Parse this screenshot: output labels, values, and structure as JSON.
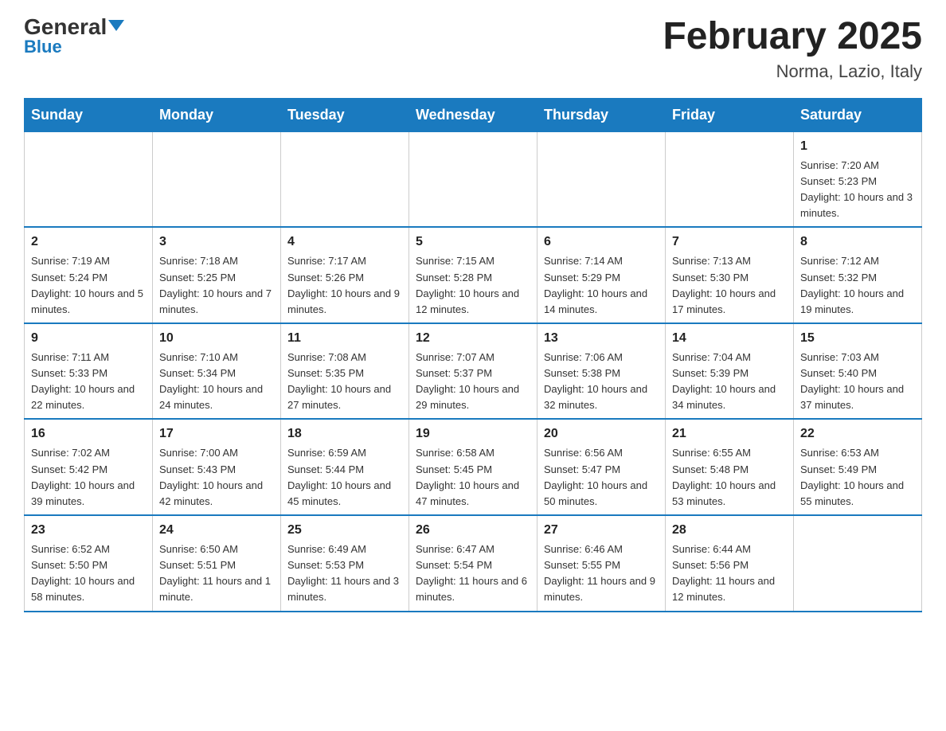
{
  "header": {
    "logo_general": "General",
    "logo_blue": "Blue",
    "month_title": "February 2025",
    "location": "Norma, Lazio, Italy"
  },
  "days_of_week": [
    "Sunday",
    "Monday",
    "Tuesday",
    "Wednesday",
    "Thursday",
    "Friday",
    "Saturday"
  ],
  "weeks": [
    [
      {
        "day": "",
        "info": ""
      },
      {
        "day": "",
        "info": ""
      },
      {
        "day": "",
        "info": ""
      },
      {
        "day": "",
        "info": ""
      },
      {
        "day": "",
        "info": ""
      },
      {
        "day": "",
        "info": ""
      },
      {
        "day": "1",
        "info": "Sunrise: 7:20 AM\nSunset: 5:23 PM\nDaylight: 10 hours and 3 minutes."
      }
    ],
    [
      {
        "day": "2",
        "info": "Sunrise: 7:19 AM\nSunset: 5:24 PM\nDaylight: 10 hours and 5 minutes."
      },
      {
        "day": "3",
        "info": "Sunrise: 7:18 AM\nSunset: 5:25 PM\nDaylight: 10 hours and 7 minutes."
      },
      {
        "day": "4",
        "info": "Sunrise: 7:17 AM\nSunset: 5:26 PM\nDaylight: 10 hours and 9 minutes."
      },
      {
        "day": "5",
        "info": "Sunrise: 7:15 AM\nSunset: 5:28 PM\nDaylight: 10 hours and 12 minutes."
      },
      {
        "day": "6",
        "info": "Sunrise: 7:14 AM\nSunset: 5:29 PM\nDaylight: 10 hours and 14 minutes."
      },
      {
        "day": "7",
        "info": "Sunrise: 7:13 AM\nSunset: 5:30 PM\nDaylight: 10 hours and 17 minutes."
      },
      {
        "day": "8",
        "info": "Sunrise: 7:12 AM\nSunset: 5:32 PM\nDaylight: 10 hours and 19 minutes."
      }
    ],
    [
      {
        "day": "9",
        "info": "Sunrise: 7:11 AM\nSunset: 5:33 PM\nDaylight: 10 hours and 22 minutes."
      },
      {
        "day": "10",
        "info": "Sunrise: 7:10 AM\nSunset: 5:34 PM\nDaylight: 10 hours and 24 minutes."
      },
      {
        "day": "11",
        "info": "Sunrise: 7:08 AM\nSunset: 5:35 PM\nDaylight: 10 hours and 27 minutes."
      },
      {
        "day": "12",
        "info": "Sunrise: 7:07 AM\nSunset: 5:37 PM\nDaylight: 10 hours and 29 minutes."
      },
      {
        "day": "13",
        "info": "Sunrise: 7:06 AM\nSunset: 5:38 PM\nDaylight: 10 hours and 32 minutes."
      },
      {
        "day": "14",
        "info": "Sunrise: 7:04 AM\nSunset: 5:39 PM\nDaylight: 10 hours and 34 minutes."
      },
      {
        "day": "15",
        "info": "Sunrise: 7:03 AM\nSunset: 5:40 PM\nDaylight: 10 hours and 37 minutes."
      }
    ],
    [
      {
        "day": "16",
        "info": "Sunrise: 7:02 AM\nSunset: 5:42 PM\nDaylight: 10 hours and 39 minutes."
      },
      {
        "day": "17",
        "info": "Sunrise: 7:00 AM\nSunset: 5:43 PM\nDaylight: 10 hours and 42 minutes."
      },
      {
        "day": "18",
        "info": "Sunrise: 6:59 AM\nSunset: 5:44 PM\nDaylight: 10 hours and 45 minutes."
      },
      {
        "day": "19",
        "info": "Sunrise: 6:58 AM\nSunset: 5:45 PM\nDaylight: 10 hours and 47 minutes."
      },
      {
        "day": "20",
        "info": "Sunrise: 6:56 AM\nSunset: 5:47 PM\nDaylight: 10 hours and 50 minutes."
      },
      {
        "day": "21",
        "info": "Sunrise: 6:55 AM\nSunset: 5:48 PM\nDaylight: 10 hours and 53 minutes."
      },
      {
        "day": "22",
        "info": "Sunrise: 6:53 AM\nSunset: 5:49 PM\nDaylight: 10 hours and 55 minutes."
      }
    ],
    [
      {
        "day": "23",
        "info": "Sunrise: 6:52 AM\nSunset: 5:50 PM\nDaylight: 10 hours and 58 minutes."
      },
      {
        "day": "24",
        "info": "Sunrise: 6:50 AM\nSunset: 5:51 PM\nDaylight: 11 hours and 1 minute."
      },
      {
        "day": "25",
        "info": "Sunrise: 6:49 AM\nSunset: 5:53 PM\nDaylight: 11 hours and 3 minutes."
      },
      {
        "day": "26",
        "info": "Sunrise: 6:47 AM\nSunset: 5:54 PM\nDaylight: 11 hours and 6 minutes."
      },
      {
        "day": "27",
        "info": "Sunrise: 6:46 AM\nSunset: 5:55 PM\nDaylight: 11 hours and 9 minutes."
      },
      {
        "day": "28",
        "info": "Sunrise: 6:44 AM\nSunset: 5:56 PM\nDaylight: 11 hours and 12 minutes."
      },
      {
        "day": "",
        "info": ""
      }
    ]
  ]
}
